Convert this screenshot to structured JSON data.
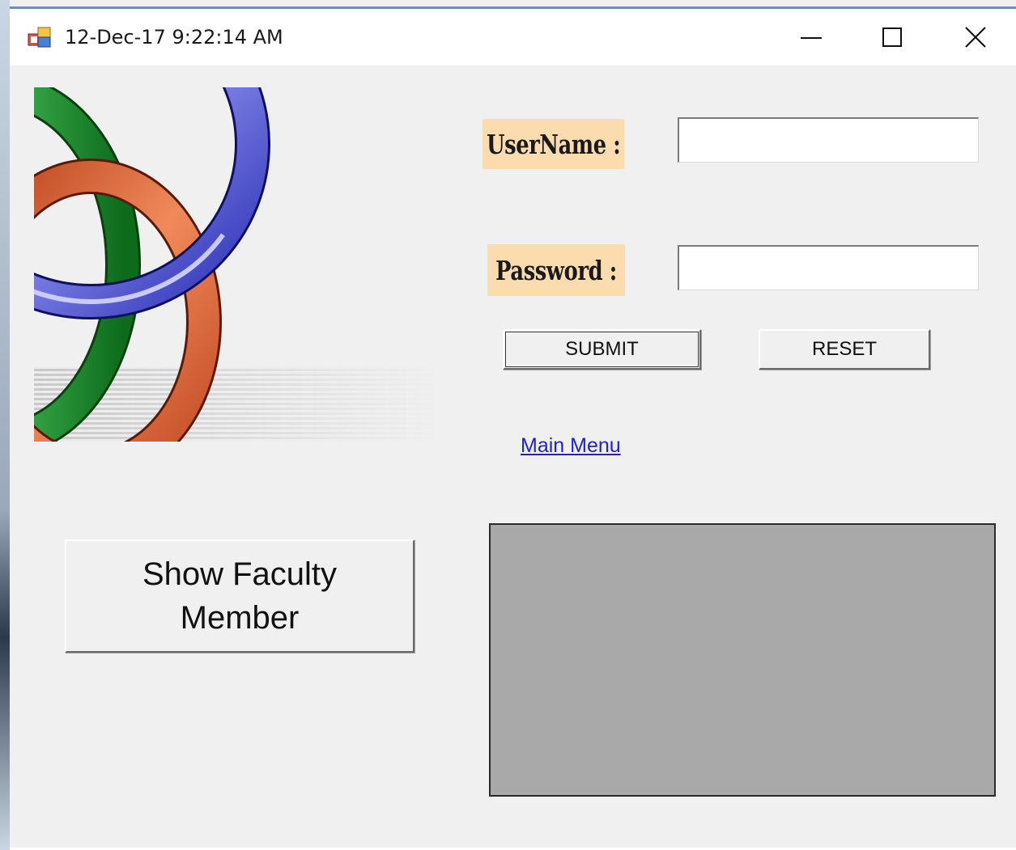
{
  "window": {
    "title": "12-Dec-17 9:22:14 AM",
    "controls": {
      "minimize_icon": "minimize-icon",
      "maximize_icon": "maximize-icon",
      "close_icon": "close-icon"
    }
  },
  "login": {
    "username_label": "UserName :",
    "username_value": "",
    "password_label": "Password :",
    "password_value": "",
    "submit_label": "SUBMIT",
    "reset_label": "RESET"
  },
  "links": {
    "main_menu": "Main Menu"
  },
  "actions": {
    "show_faculty_line1": "Show Faculty",
    "show_faculty_line2": "Member"
  },
  "colors": {
    "label_background": "#fbdcae",
    "link_color": "#1f1fd6",
    "panel_gray": "#a9a9a9",
    "window_background": "#f0f0f0"
  }
}
